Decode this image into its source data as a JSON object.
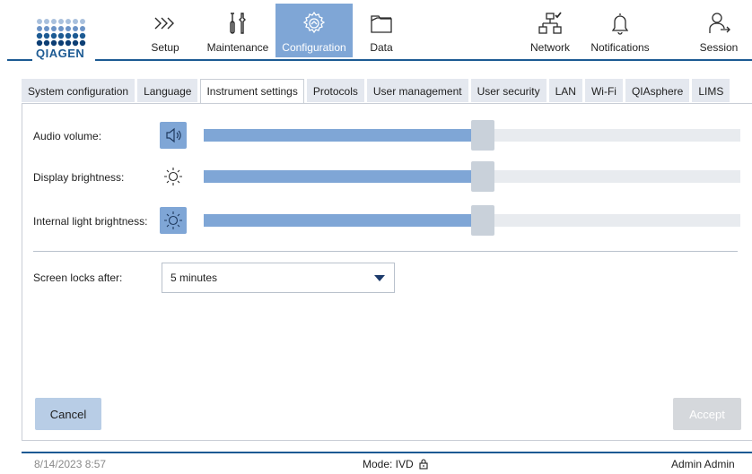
{
  "header": {
    "logo_text": "QIAGEN",
    "nav": [
      {
        "label": "Setup",
        "icon": "setup-chevrons-icon"
      },
      {
        "label": "Maintenance",
        "icon": "tools-icon"
      },
      {
        "label": "Configuration",
        "icon": "configuration-gear-icon",
        "active": true
      },
      {
        "label": "Data",
        "icon": "folder-icon"
      },
      {
        "label": "Network",
        "icon": "network-icon"
      },
      {
        "label": "Notifications",
        "icon": "bell-icon"
      },
      {
        "label": "Session",
        "icon": "session-user-icon"
      }
    ]
  },
  "tabs": [
    {
      "label": "System configuration"
    },
    {
      "label": "Language"
    },
    {
      "label": "Instrument settings",
      "active": true
    },
    {
      "label": "Protocols"
    },
    {
      "label": "User management"
    },
    {
      "label": "User security"
    },
    {
      "label": "LAN"
    },
    {
      "label": "Wi-Fi"
    },
    {
      "label": "QIAsphere"
    },
    {
      "label": "LIMS"
    }
  ],
  "settings": {
    "audio_volume": {
      "label": "Audio volume:",
      "value_fraction": 0.52
    },
    "display_brightness": {
      "label": "Display brightness:",
      "value_fraction": 0.52
    },
    "internal_light": {
      "label": "Internal light brightness:",
      "value_fraction": 0.52
    },
    "screen_lock": {
      "label": "Screen locks after:",
      "selected": "5 minutes"
    }
  },
  "buttons": {
    "cancel": "Cancel",
    "accept": "Accept"
  },
  "footer": {
    "datetime": "8/14/2023 8:57",
    "mode": "Mode: IVD",
    "user": "Admin Admin"
  },
  "colors": {
    "accent": "#7fa6d6",
    "brand_line": "#1c5a93",
    "tab_bg": "#e4e8ef",
    "disabled": "#d5d8dc"
  }
}
